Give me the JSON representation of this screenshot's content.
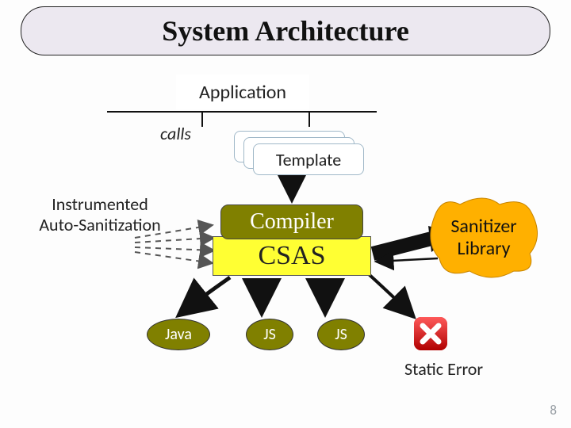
{
  "title": "System Architecture",
  "application_label": "Application",
  "calls_label": "calls",
  "template_label": "Template",
  "instrumented_label_line1": "Instrumented",
  "instrumented_label_line2": "Auto-Sanitization",
  "compiler_label": "Compiler",
  "csas_label": "CSAS",
  "sanitizer_label_line1": "Sanitizer",
  "sanitizer_label_line2": "Library",
  "outputs": {
    "java": "Java",
    "js1": "JS",
    "js2": "JS"
  },
  "static_error_label": "Static Error",
  "page_number": "8"
}
